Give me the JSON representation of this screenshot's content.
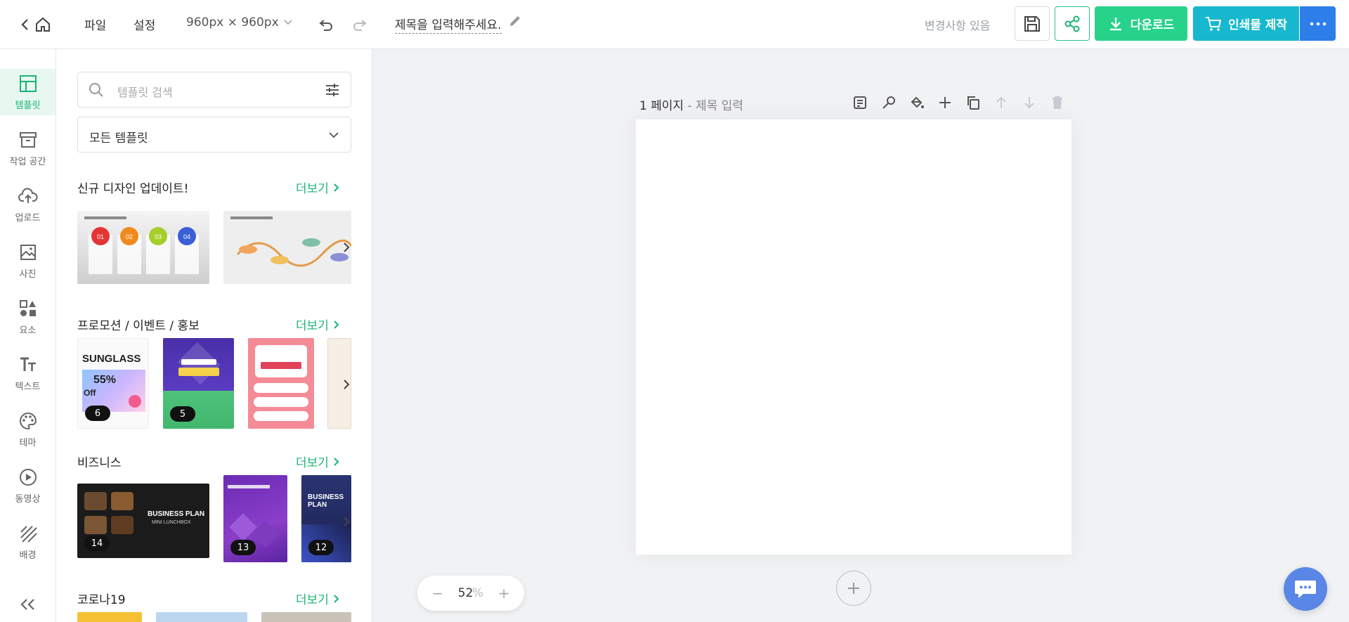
{
  "header": {
    "menu": {
      "file": "파일",
      "settings": "설정"
    },
    "canvas_size": "960px ⨯ 960px",
    "doc_title": "제목을 입력해주세요.",
    "changes_status": "변경사항 있음",
    "download_label": "다운로드",
    "print_label": "인쇄물 제작"
  },
  "rail": {
    "items": [
      {
        "label": "템플릿",
        "icon": "template-icon"
      },
      {
        "label": "작업 공간",
        "icon": "workspace-icon"
      },
      {
        "label": "업로드",
        "icon": "upload-icon"
      },
      {
        "label": "사진",
        "icon": "photo-icon"
      },
      {
        "label": "요소",
        "icon": "elements-icon"
      },
      {
        "label": "텍스트",
        "icon": "text-icon"
      },
      {
        "label": "테마",
        "icon": "palette-icon"
      },
      {
        "label": "동영상",
        "icon": "video-icon"
      },
      {
        "label": "배경",
        "icon": "background-icon"
      }
    ]
  },
  "panel": {
    "search_placeholder": "템플릿 검색",
    "category_selected": "모든 템플릿",
    "more_label": "더보기",
    "sections": [
      {
        "title": "신규 디자인 업데이트!"
      },
      {
        "title": "프로모션 / 이벤트 / 홍보",
        "counts": [
          "6",
          "5"
        ]
      },
      {
        "title": "비즈니스",
        "counts": [
          "14",
          "13",
          "12"
        ]
      },
      {
        "title": "코로나19"
      }
    ],
    "thumb_texts": {
      "sunglass": "SUNGLASS",
      "sunglass_pct": "55%",
      "sunglass_off": "Off",
      "biz_title": "BUSINESS PLAN",
      "biz_sub": "MINI LUNCHBOX",
      "biz3_title": "BUSINESS PLAN",
      "numbers": [
        "01",
        "02",
        "03",
        "04"
      ]
    }
  },
  "canvas": {
    "page_number": "1 페이지",
    "page_title_placeholder": "- 제목 입력"
  },
  "zoom": {
    "value": "52",
    "unit": "%",
    "minus": "−",
    "plus": "+"
  }
}
